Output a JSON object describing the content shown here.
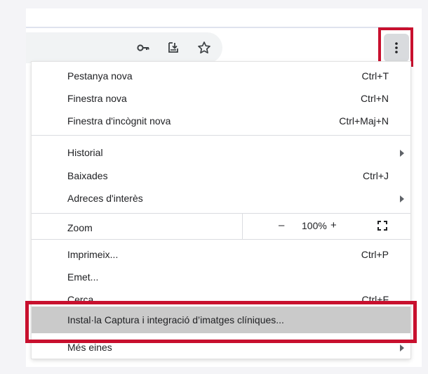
{
  "toolbar": {
    "icons": [
      "key-icon",
      "install-app-icon",
      "bookmark-star-icon"
    ],
    "menu_icon": "three-dots-vertical-icon"
  },
  "menu": {
    "new_tab": {
      "label": "Pestanya nova",
      "shortcut": "Ctrl+T"
    },
    "new_window": {
      "label": "Finestra nova",
      "shortcut": "Ctrl+N"
    },
    "incognito": {
      "label": "Finestra d'incògnit nova",
      "shortcut": "Ctrl+Maj+N"
    },
    "history": {
      "label": "Historial"
    },
    "downloads": {
      "label": "Baixades",
      "shortcut": "Ctrl+J"
    },
    "bookmarks": {
      "label": "Adreces d'interès"
    },
    "zoom": {
      "label": "Zoom",
      "minus": "–",
      "value": "100%",
      "plus": "+"
    },
    "print": {
      "label": "Imprimeix...",
      "shortcut": "Ctrl+P"
    },
    "cast": {
      "label": "Emet..."
    },
    "find": {
      "label": "Cerca...",
      "shortcut": "Ctrl+F"
    },
    "install": {
      "label": "Instal·la Captura i integració d’imatges clíniques..."
    },
    "more_tools": {
      "label": "Més eines"
    }
  },
  "colors": {
    "highlight": "#c8102e",
    "hover": "#cacaca"
  }
}
